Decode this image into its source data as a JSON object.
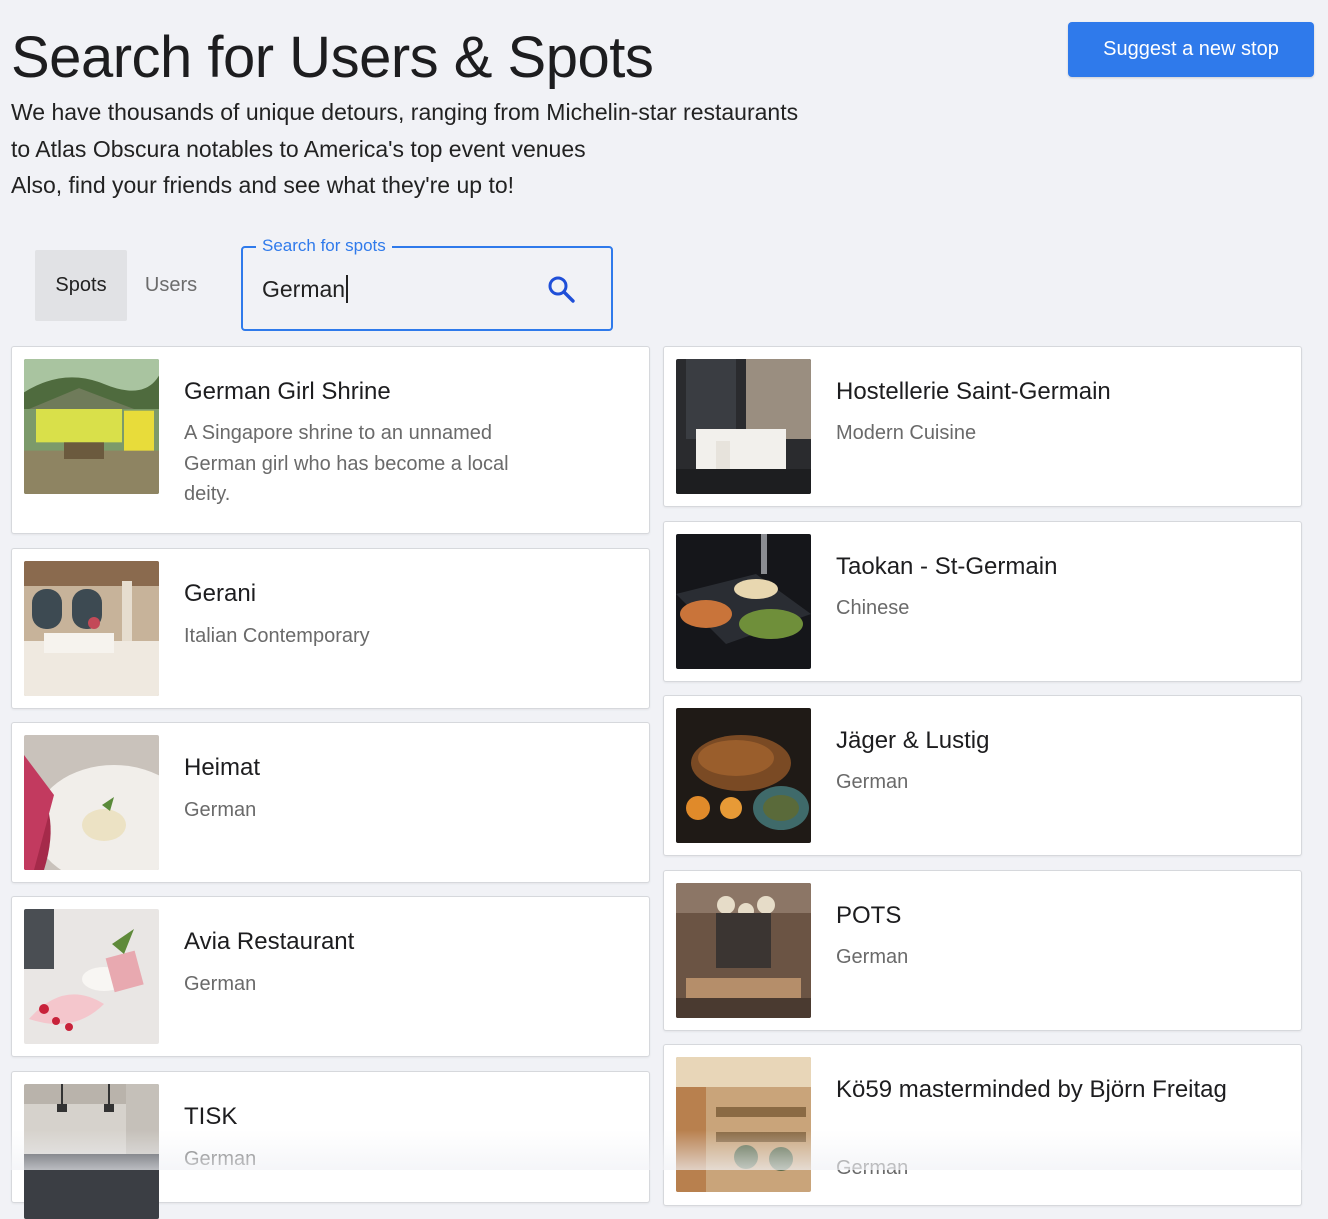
{
  "header": {
    "title": "Search for Users & Spots",
    "intro_lines": [
      "We have thousands of unique detours, ranging from Michelin-star restaurants",
      "to Atlas Obscura notables to America's top event venues",
      "Also, find your friends and see what they're up to!"
    ],
    "suggest_button": "Suggest a new stop"
  },
  "search": {
    "tabs": [
      "Spots",
      "Users"
    ],
    "active_tab": "Spots",
    "legend": "Search for spots",
    "value": "German",
    "icon": "search-icon"
  },
  "results": {
    "left": [
      {
        "title": "German Girl Shrine",
        "subtitle": "A Singapore shrine to an unnamed German girl who has become a local deity."
      },
      {
        "title": "Gerani",
        "subtitle": "Italian Contemporary"
      },
      {
        "title": "Heimat",
        "subtitle": "German"
      },
      {
        "title": "Avia Restaurant",
        "subtitle": "German"
      },
      {
        "title": "TISK",
        "subtitle": "German"
      }
    ],
    "right": [
      {
        "title": "Hostellerie Saint-Germain",
        "subtitle": "Modern Cuisine"
      },
      {
        "title": "Taokan - St-Germain",
        "subtitle": "Chinese"
      },
      {
        "title": "Jäger & Lustig",
        "subtitle": "German"
      },
      {
        "title": "POTS",
        "subtitle": "German"
      },
      {
        "title": "Kö59 masterminded by Björn Freitag",
        "subtitle": "German"
      }
    ]
  },
  "colors": {
    "accent": "#2f7aeb",
    "background": "#f1f2f6"
  }
}
